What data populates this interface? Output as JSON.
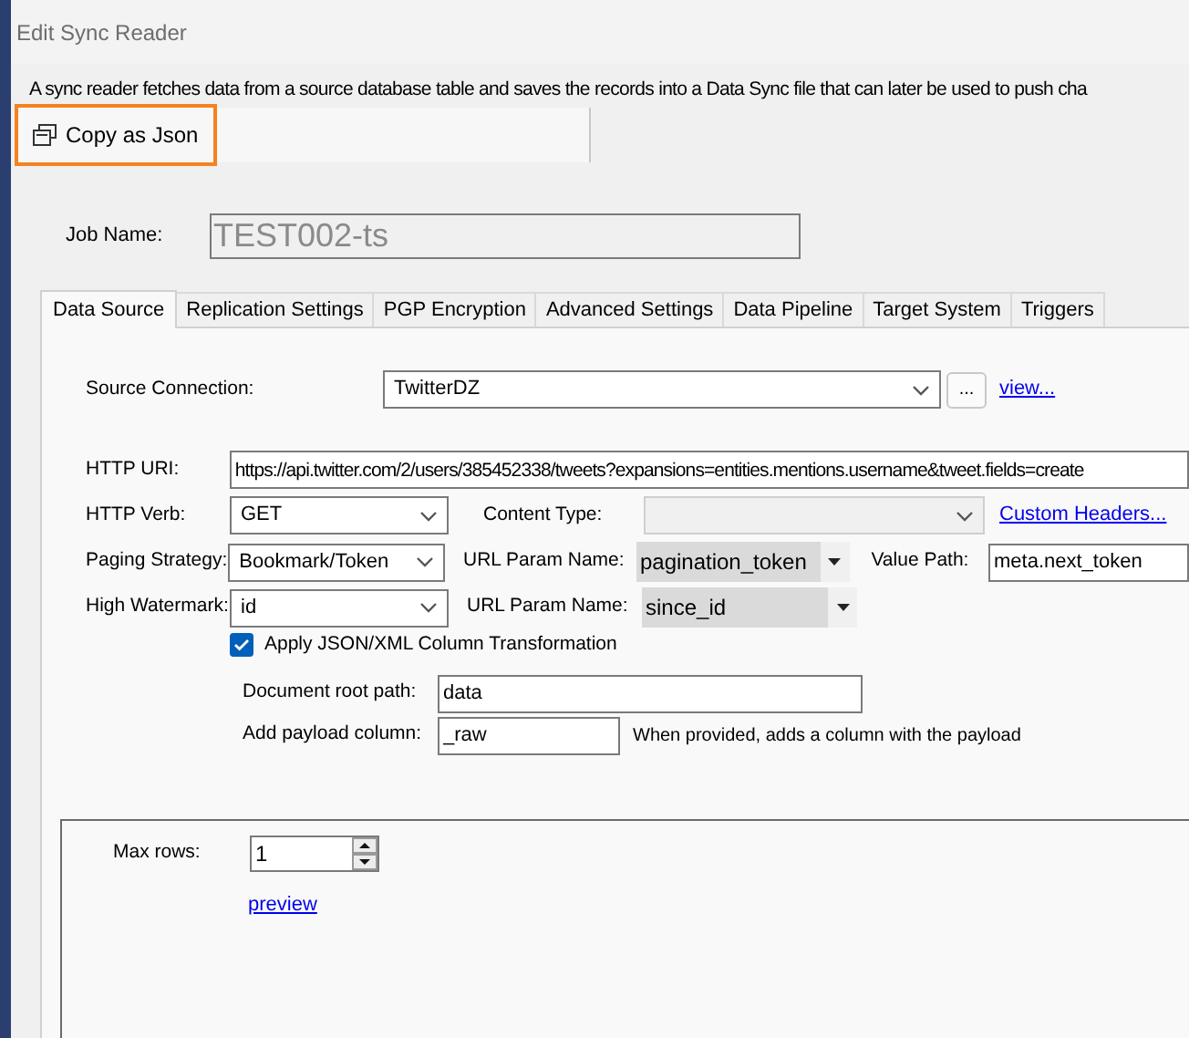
{
  "window": {
    "title": "Edit Sync Reader"
  },
  "description": "A sync reader fetches data from a source database table and saves the records into a Data Sync file that can later be used to push cha",
  "toolbar": {
    "buttons": [
      {
        "label": "Copy as Json",
        "highlighted": true
      }
    ]
  },
  "job_name": {
    "label": "Job Name:",
    "value": "TEST002-ts"
  },
  "tabs": [
    {
      "label": "Data Source",
      "selected": true
    },
    {
      "label": "Replication Settings",
      "selected": false
    },
    {
      "label": "PGP Encryption",
      "selected": false
    },
    {
      "label": "Advanced Settings",
      "selected": false
    },
    {
      "label": "Data Pipeline",
      "selected": false
    },
    {
      "label": "Target System",
      "selected": false
    },
    {
      "label": "Triggers",
      "selected": false
    }
  ],
  "source_connection": {
    "label": "Source Connection:",
    "value": "TwitterDZ",
    "browse_button": "...",
    "view_link": "view..."
  },
  "http_uri": {
    "label": "HTTP URI:",
    "value": "https://api.twitter.com/2/users/385452338/tweets?expansions=entities.mentions.username&tweet.fields=create"
  },
  "http_verb": {
    "label": "HTTP Verb:",
    "value": "GET"
  },
  "content_type": {
    "label": "Content Type:",
    "disabled": true
  },
  "custom_headers_link": "Custom Headers...",
  "paging_strategy": {
    "label": "Paging Strategy:",
    "value": "Bookmark/Token"
  },
  "paging_param": {
    "label": "URL Param Name:",
    "value": "pagination_token"
  },
  "value_path": {
    "label": "Value Path:",
    "value": "meta.next_token"
  },
  "high_watermark": {
    "label": "High Watermark:",
    "value": "id"
  },
  "watermark_param": {
    "label": "URL Param Name:",
    "value": "since_id"
  },
  "transformation": {
    "label": "Apply JSON/XML Column Transformation",
    "checked": true
  },
  "document_root_path": {
    "label": "Document root path:",
    "value": "data"
  },
  "payload_column": {
    "label": "Add payload column:",
    "value": "_raw",
    "hint": "When provided, adds a column with the payload"
  },
  "max_rows": {
    "label": "Max rows:",
    "value": "1"
  },
  "preview_link": "preview"
}
